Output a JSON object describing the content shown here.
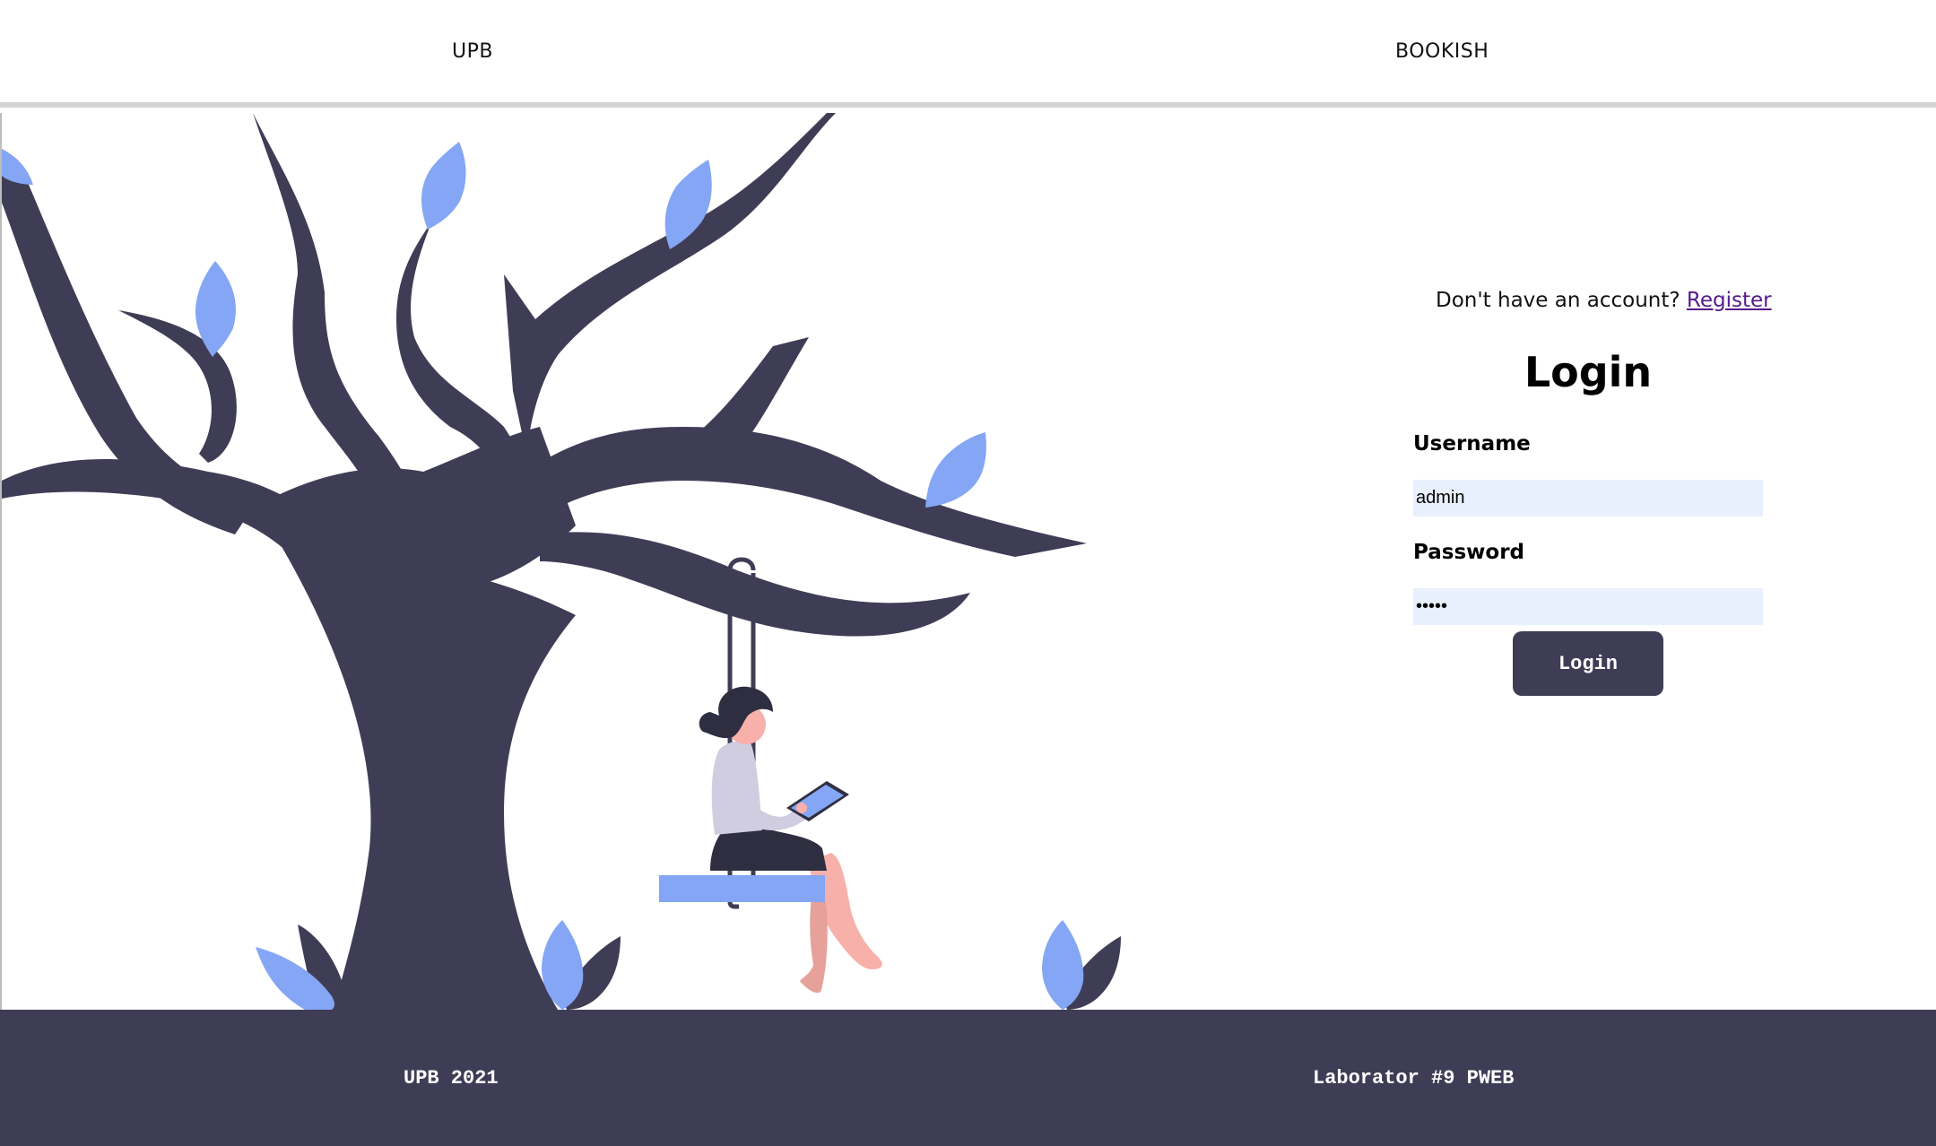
{
  "header": {
    "left_link": "UPB",
    "right_link": "BOOKISH"
  },
  "login": {
    "register_prompt": "Don't have an account?",
    "register_link": "Register",
    "title": "Login",
    "username_label": "Username",
    "username_value": "admin",
    "password_label": "Password",
    "password_value": "admin",
    "submit_label": "Login"
  },
  "footer": {
    "left_text": "UPB 2021",
    "right_text": "Laborator #9 PWEB"
  },
  "colors": {
    "primary_dark": "#3f3d56",
    "leaf_blue": "#84a6f4",
    "input_background": "#e8f0fe",
    "link_visited": "#551a8b",
    "header_border": "#d3d3d3"
  },
  "illustration": {
    "subject": "tree-with-woman-on-swing-reading-tablet"
  }
}
